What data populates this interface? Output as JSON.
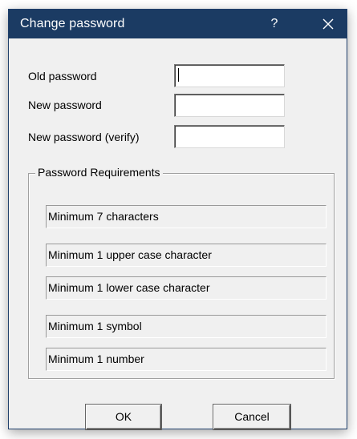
{
  "window": {
    "title": "Change password",
    "help_label": "?",
    "close_icon": "close-icon"
  },
  "form": {
    "old_password_label": "Old password",
    "old_password_value": "",
    "new_password_label": "New password",
    "new_password_value": "",
    "verify_password_label": "New password (verify)",
    "verify_password_value": ""
  },
  "requirements": {
    "legend": "Password Requirements",
    "items": [
      "Minimum 7 characters",
      "Minimum 1 upper case character",
      "Minimum 1 lower case character",
      "Minimum 1 symbol",
      "Minimum 1 number"
    ]
  },
  "buttons": {
    "ok_label": "OK",
    "cancel_label": "Cancel"
  },
  "colors": {
    "titlebar": "#1b3b63",
    "dialog_background": "#f0f0f0"
  }
}
